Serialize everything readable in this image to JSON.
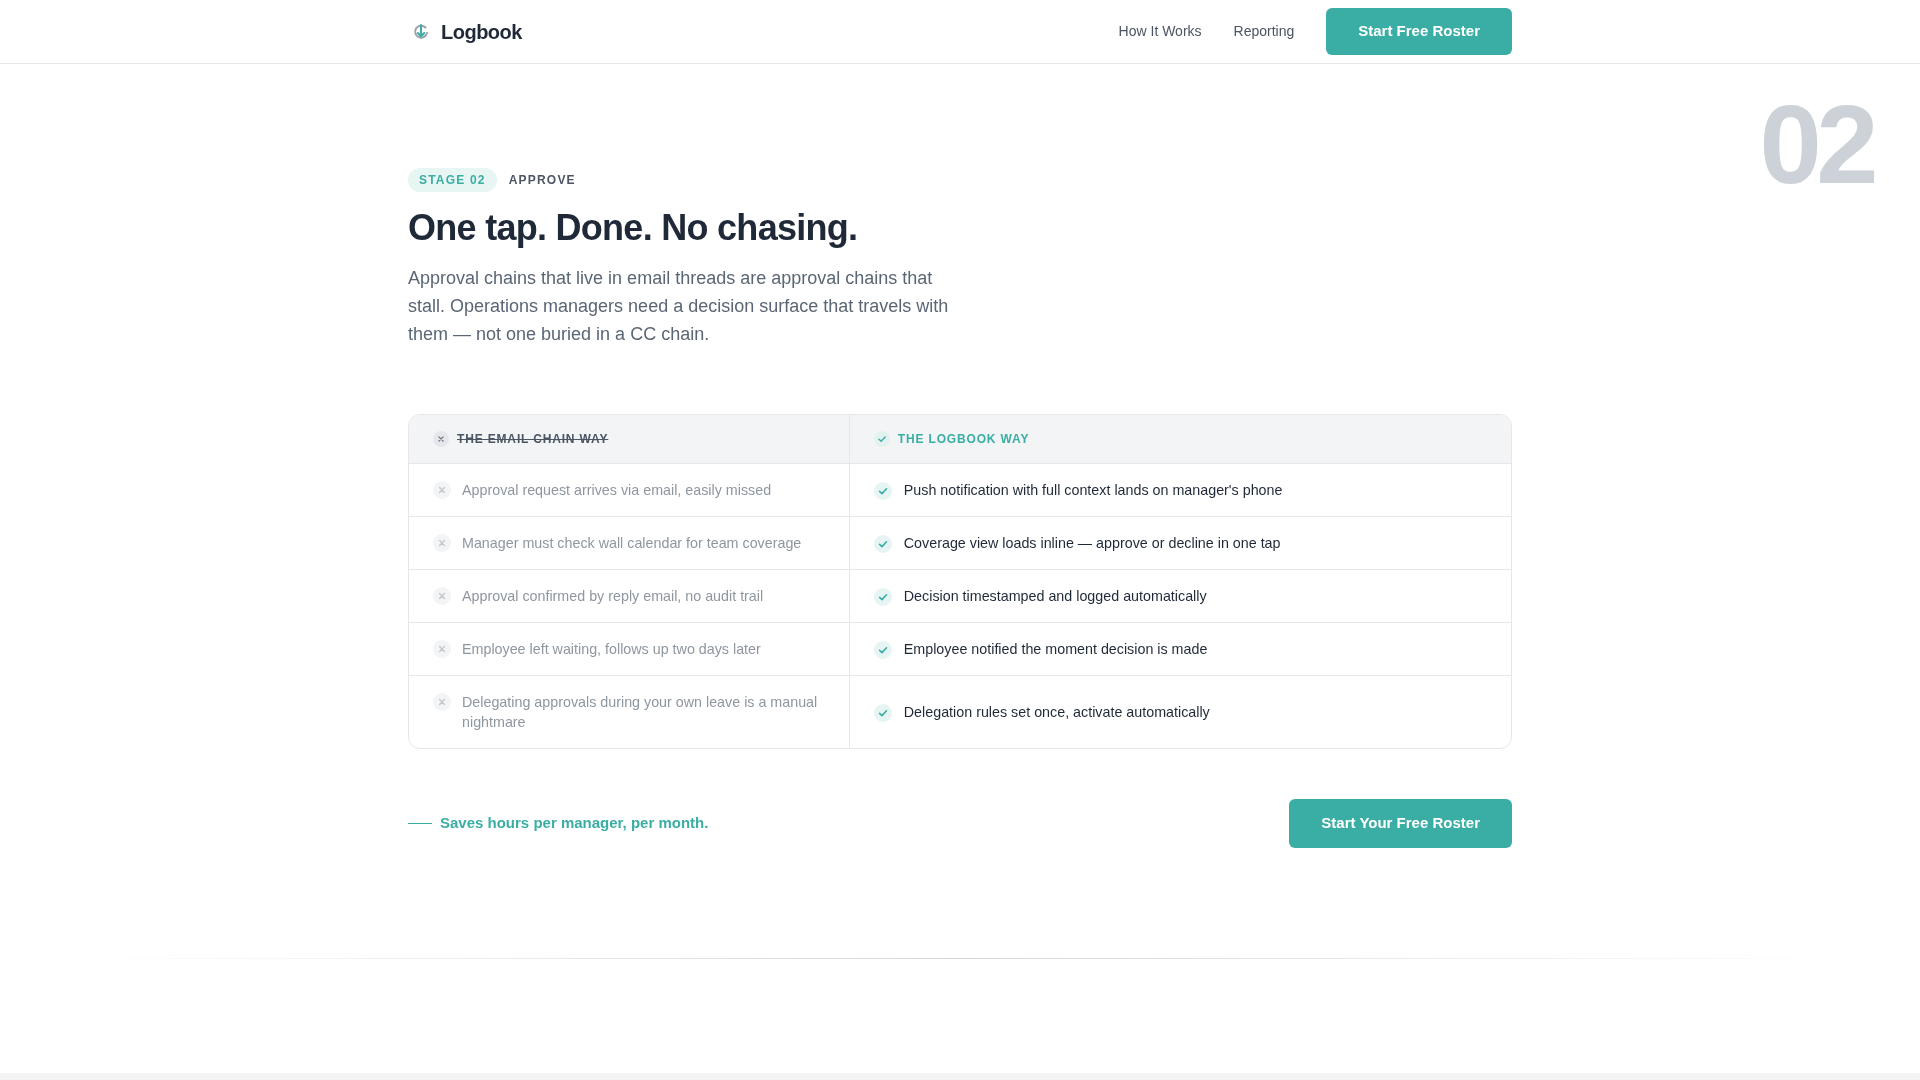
{
  "header": {
    "logo": "Logbook",
    "nav_links": [
      "How It Works",
      "Reporting"
    ],
    "cta_button": "Start Free Roster"
  },
  "stage": {
    "number": "02",
    "badge": "STAGE 02",
    "name": "APPROVE",
    "title": "One tap. Done. No chasing.",
    "description": "Approval chains that live in email threads are approval chains that stall. Operations managers need a decision surface that travels with them — not one buried in a CC chain."
  },
  "comparison": {
    "columns": [
      {
        "label": "THE EMAIL CHAIN WAY",
        "kind": "old"
      },
      {
        "label": "THE LOGBOOK WAY",
        "kind": "new"
      }
    ],
    "rows": [
      {
        "cells": [
          "Approval request arrives via email, easily missed",
          "Push notification with full context lands on manager's phone"
        ]
      },
      {
        "cells": [
          "Manager must check wall calendar for team coverage",
          "Coverage view loads inline — approve or decline in one tap"
        ]
      },
      {
        "cells": [
          "Approval confirmed by reply email, no audit trail",
          "Decision timestamped and logged automatically"
        ]
      },
      {
        "cells": [
          "Employee left waiting, follows up two days later",
          "Employee notified the moment decision is made"
        ]
      },
      {
        "cells": [
          "Delegating approvals during your own leave is a manual nightmare",
          "Delegation rules set once, activate automatically"
        ]
      }
    ]
  },
  "footer_cta": {
    "tagline": "Saves hours per manager, per month.",
    "button": "Start Your Free Roster"
  }
}
